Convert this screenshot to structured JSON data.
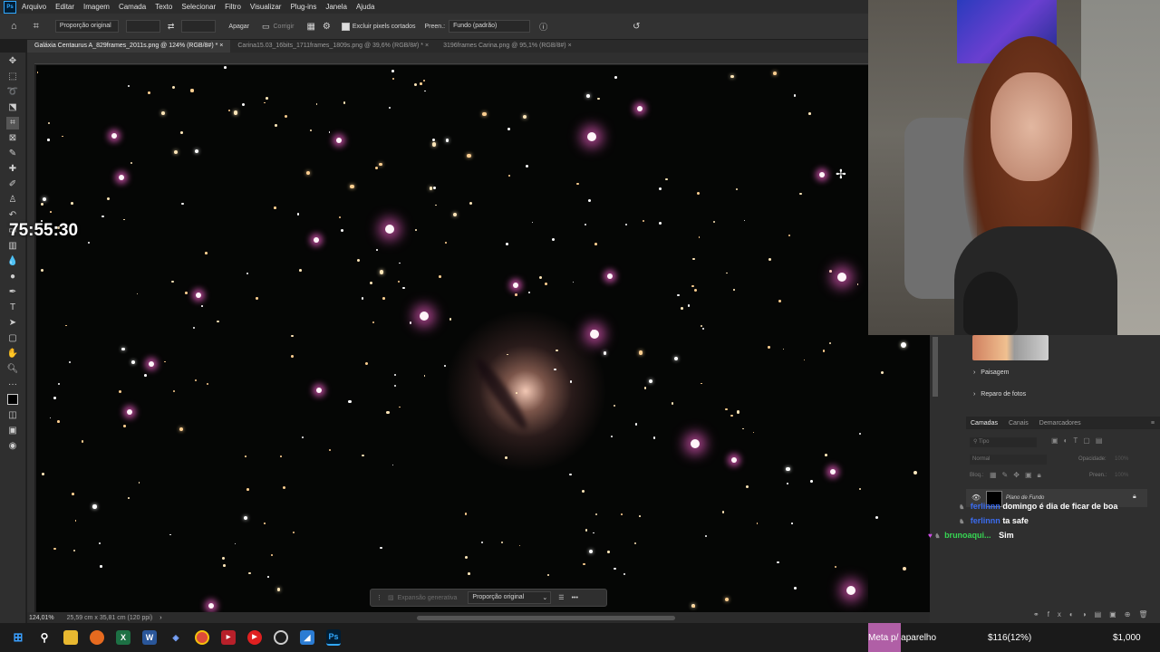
{
  "menubar": {
    "logo": "Ps",
    "items": [
      "Arquivo",
      "Editar",
      "Imagem",
      "Camada",
      "Texto",
      "Selecionar",
      "Filtro",
      "Visualizar",
      "Plug-ins",
      "Janela",
      "Ajuda"
    ]
  },
  "options": {
    "ratio": "Proporção original",
    "clear": "Apagar",
    "straighten": "Corrigir",
    "delete_cropped": "Excluir pixels cortados",
    "fill_label": "Preen.:",
    "fill_value": "Fundo (padrão)"
  },
  "tabs": [
    {
      "label": "Galáxia Centaurus A_829frames_2011s.png @ 124% (RGB/8#) *",
      "active": true
    },
    {
      "label": "Carina15.03_16bits_1711frames_1809s.png @ 39,6% (RGB/8#) *",
      "active": false
    },
    {
      "label": "3196frames Carina.png @ 95,1% (RGB/8#)",
      "active": false
    }
  ],
  "overlay": {
    "timer": "75:55:30"
  },
  "context_bar": {
    "generative": "Expansão generativa",
    "ratio": "Proporção original"
  },
  "status": {
    "zoom": "124,01%",
    "doc": "25,59 cm x 35,81 cm (120 ppi)"
  },
  "panels": {
    "adjust_items": [
      "Paisagem",
      "Reparo de fotos"
    ],
    "layer_tabs": [
      "Camadas",
      "Canais",
      "Demarcadores"
    ],
    "search_placeholder": "Tipo",
    "blend_mode": "Normal",
    "opacity_label": "Opacidade:",
    "opacity_value": "100%",
    "lock_label": "Bloq.:",
    "fill_label": "Preen.:",
    "fill_value": "100%",
    "layer_name": "Plano de Fundo"
  },
  "chat": [
    {
      "user": "ferlinnn",
      "message": "domingo é dia de ficar de boa",
      "color": "#3b6cf0"
    },
    {
      "user": "ferlinnn",
      "message": "ta safe",
      "color": "#3b6cf0"
    },
    {
      "user": "brunoaqui...",
      "message": "Sim",
      "color": "#37d653"
    }
  ],
  "goal": {
    "label": "Meta p/ aparelho",
    "current": "$116(12%)",
    "target": "$1,000",
    "progress": 0.12
  },
  "colors": {
    "goal_fill": "#b05fa6",
    "chat_blue": "#3b6cf0",
    "chat_green": "#37d653"
  }
}
